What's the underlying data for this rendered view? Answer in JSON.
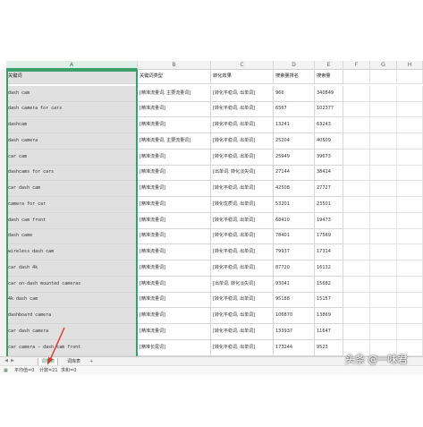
{
  "columns": [
    "A",
    "B",
    "C",
    "D",
    "E",
    "F",
    "G",
    "H"
  ],
  "rows": [
    [
      "关键词",
      "关键词类型",
      "转化效果",
      "搜索量排名",
      "搜索量"
    ],
    [
      "dash cam",
      "[精准流量词, 主要流量词]",
      "[转化平稳词, 出单词]",
      "966",
      "340849"
    ],
    [
      "dash camera for cars",
      "[精准流量词]",
      "[转化平稳词, 出单词]",
      "6567",
      "102377"
    ],
    [
      "dashcam",
      "[精准流量词]",
      "[转化平稳词, 出单词]",
      "13241",
      "63243"
    ],
    [
      "dash camera",
      "[精准流量词, 主要流量词]",
      "[转化平稳词, 出单词]",
      "25204",
      "40509"
    ],
    [
      "car cam",
      "[精准流量词]",
      "[转化平稳词, 出单词]",
      "25949",
      "39673"
    ],
    [
      "dashcams for cars",
      "[精准流量词]",
      "[出单词, 转化淡失词]",
      "27144",
      "38414"
    ],
    [
      "car dash cam",
      "[精准流量词]",
      "[转化平稳词, 出单词]",
      "42508",
      "27727"
    ],
    [
      "camera for car",
      "[精准流量词]",
      "[转化优质词, 出单词]",
      "53201",
      "23501"
    ],
    [
      "dash cam front",
      "[精准流量词]",
      "[转化平稳词, 出单词]",
      "68410",
      "19473"
    ],
    [
      "dash came",
      "[精准流量词]",
      "[转化平稳词, 出单词]",
      "78401",
      "17569"
    ],
    [
      "wireless dash cam",
      "[精准流量词]",
      "[转化平稳词, 出单词]",
      "79937",
      "17314"
    ],
    [
      "car dash 4k",
      "[精准流量词]",
      "[转化平稳词, 出单词]",
      "87720",
      "16132"
    ],
    [
      "car on-dash mounted cameras",
      "[精准流量词]",
      "[出单词, 转化淡失词]",
      "93041",
      "15682"
    ],
    [
      "4k dash cam",
      "[精准流量词]",
      "[转化平稳词, 出单词]",
      "95188",
      "15157"
    ],
    [
      "dashboard camera",
      "[精准流量词]",
      "[转化平稳词, 出单词]",
      "106870",
      "13869"
    ],
    [
      "car dash camera",
      "[精准流量词]",
      "[转化平稳词, 出单词]",
      "133937",
      "11647"
    ],
    [
      "car camera - dash cam front",
      "[精准长尾词]",
      "[转化平稳词, 出单词]",
      "173244",
      "9523"
    ]
  ],
  "sheet_tabs": [
    "词根表",
    "词库表"
  ],
  "add_tab": "+",
  "status": {
    "average": "平均值=0",
    "count": "计数=21",
    "sum": "求和=0"
  },
  "watermark": "头条 @一味君",
  "colors": {
    "selection": "#3aa06a",
    "cell_a_fill": "#e0e0e0",
    "arrow": "#d9332b"
  }
}
